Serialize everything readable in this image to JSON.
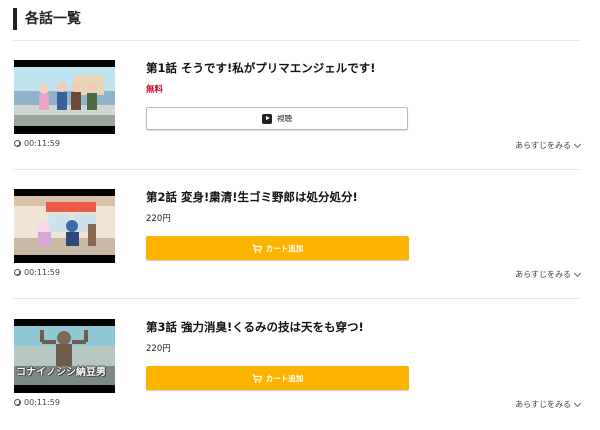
{
  "section": {
    "title": "各話一覧"
  },
  "episodes": [
    {
      "title": "第1話 そうです!私がプリマエンジェルです!",
      "price": "無料",
      "duration": "00:11:59",
      "action_label": "視聴",
      "synopsis_label": "あらすじをみる"
    },
    {
      "title": "第2話 変身!粛清!生ゴミ野郎は処分処分!",
      "price": "220円",
      "duration": "00:11:59",
      "action_label": "カート追加",
      "synopsis_label": "あらすじをみる"
    },
    {
      "title": "第3話 強力消臭!くるみの技は天をも穿つ!",
      "price": "220円",
      "duration": "00:11:59",
      "action_label": "カート追加",
      "synopsis_label": "あらすじをみる",
      "thumbnail_caption": "コナイノシシ納豆男"
    }
  ],
  "colors": {
    "free_price": "#c8102e",
    "cart_button": "#fcb400"
  },
  "icons": [
    "clock-icon",
    "play-icon",
    "cart-icon",
    "chevron-down-icon"
  ]
}
